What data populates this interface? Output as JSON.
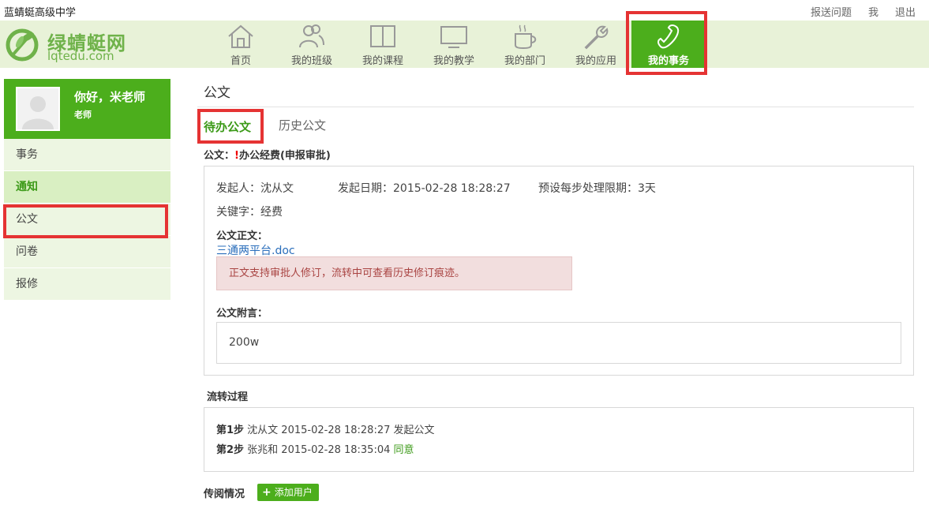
{
  "school_name": "蓝蜻蜓高级中学",
  "top_links": [
    "报送问题",
    "我",
    "退出"
  ],
  "logo": {
    "cn": "绿蜻蜓网",
    "en": "lqtedu.com"
  },
  "nav": [
    {
      "label": "首页",
      "icon": "home-icon"
    },
    {
      "label": "我的班级",
      "icon": "users-icon"
    },
    {
      "label": "我的课程",
      "icon": "book-icon"
    },
    {
      "label": "我的教学",
      "icon": "monitor-icon"
    },
    {
      "label": "我的部门",
      "icon": "cup-icon"
    },
    {
      "label": "我的应用",
      "icon": "wrench-icon"
    },
    {
      "label": "我的事务",
      "icon": "phone-icon",
      "active": true
    }
  ],
  "profile": {
    "greeting": "你好，米老师",
    "role": "老师"
  },
  "sidebar": [
    {
      "label": "事务"
    },
    {
      "label": "通知",
      "active": true
    },
    {
      "label": "公文"
    },
    {
      "label": "问卷"
    },
    {
      "label": "报修"
    }
  ],
  "page_title": "公文",
  "tabs": {
    "pending": "待办公文",
    "history": "历史公文"
  },
  "doc": {
    "head_prefix": "公文：",
    "head_mark": "!",
    "head_title": "办公经费(申报审批)",
    "initiator": "发起人：沈从文",
    "date": "发起日期：2015-02-28 18:28:27",
    "deadline": "预设每步处理限期：3天",
    "keyword": "关键字：经费",
    "body_label": "公文正文：",
    "attachment": "三通两平台.doc",
    "alert": "正文支持审批人修订，流转中可查看历史修订痕迹。",
    "note_label": "公文附言：",
    "note": "200w"
  },
  "flow": {
    "title": "流转过程",
    "steps": [
      {
        "step": "第1步",
        "text": " 沈从文 2015-02-28 18:28:27 发起公文",
        "status": ""
      },
      {
        "step": "第2步",
        "text": " 张兆和 2015-02-28 18:35:04 ",
        "status": "同意"
      }
    ]
  },
  "circulation": {
    "title": "传阅情况",
    "add_button": "添加用户"
  },
  "colors": {
    "accent": "#4cae1c",
    "highlight": "#e53333",
    "header_bg": "#e8f2d8"
  }
}
